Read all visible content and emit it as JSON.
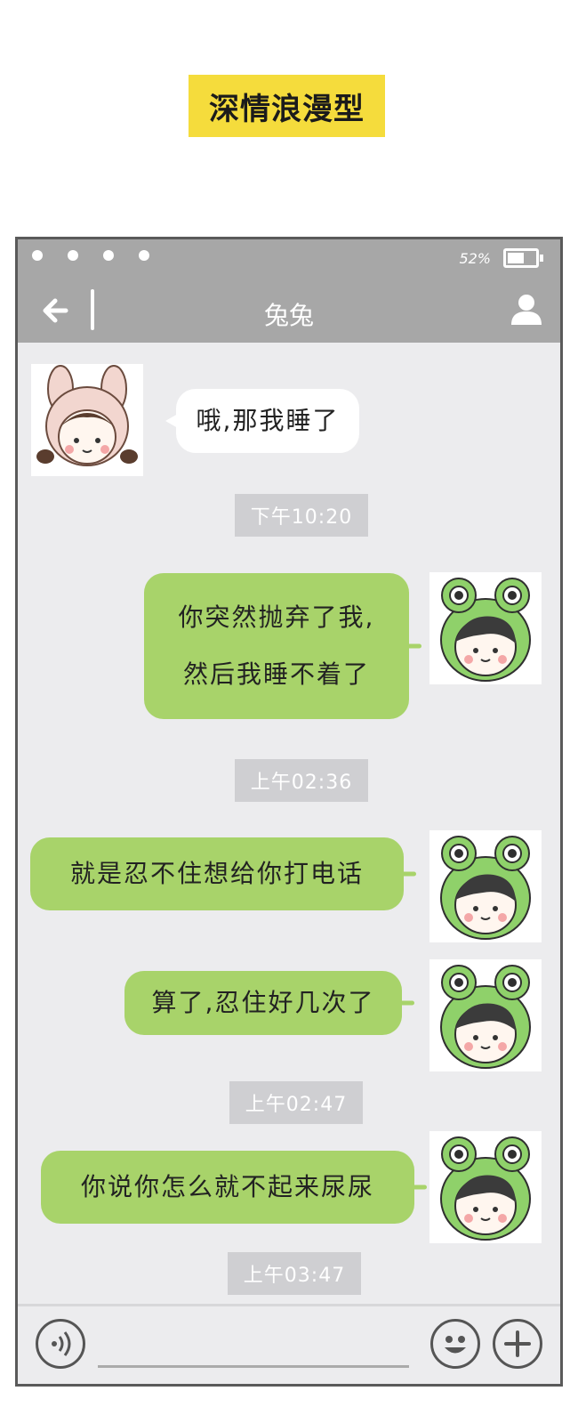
{
  "title_tag": "深情浪漫型",
  "status_bar": {
    "battery_text": "52%"
  },
  "nav": {
    "title": "兔兔"
  },
  "messages": [
    {
      "side": "left",
      "text": "哦,那我睡了"
    },
    {
      "side": "right",
      "line1": "你突然抛弃了我,",
      "line2": "然后我睡不着了"
    },
    {
      "side": "right",
      "text": "就是忍不住想给你打电话"
    },
    {
      "side": "right",
      "text": "算了,忍住好几次了"
    },
    {
      "side": "right",
      "text": "你说你怎么就不起来尿尿"
    }
  ],
  "timestamps": [
    "下午10:20",
    "上午02:36",
    "上午02:47",
    "上午03:47"
  ],
  "colors": {
    "accent_yellow": "#f5dc3c",
    "bar_gray": "#a7a7a7",
    "bubble_green": "#a8d36a",
    "chat_bg": "#ececee"
  },
  "icons": [
    "back-arrow-icon",
    "profile-icon",
    "voice-icon",
    "emoji-icon",
    "plus-icon",
    "battery-icon"
  ]
}
